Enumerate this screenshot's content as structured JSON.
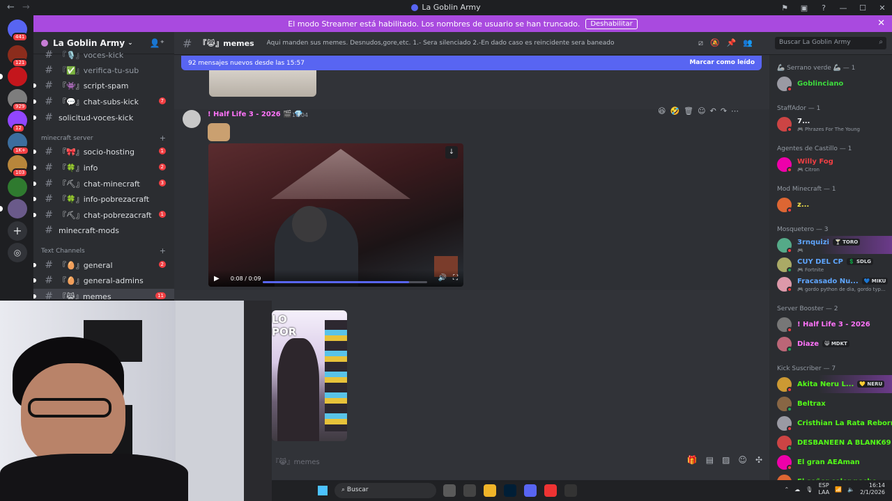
{
  "window": {
    "title": "La Goblin Army"
  },
  "banner": {
    "text": "El modo Streamer está habilitado. Los nombres de usuario se han truncado.",
    "button": "Deshabilitar"
  },
  "servers": [
    {
      "badge": "441"
    },
    {
      "badge": "121"
    },
    {
      "badge": ""
    },
    {
      "badge": "929"
    },
    {
      "badge": "12"
    },
    {
      "badge": "1K+"
    },
    {
      "badge": "103"
    },
    {
      "badge": ""
    },
    {
      "badge": ""
    }
  ],
  "sidebar": {
    "server_name": "La Goblin Army",
    "channels_top": [
      {
        "name": "『🎙️』voces-kick",
        "count": ""
      },
      {
        "name": "『✅』verifica-tu-sub",
        "count": ""
      },
      {
        "name": "『👾』script-spam",
        "count": ""
      },
      {
        "name": "『💬』chat-subs-kick",
        "count": "7"
      },
      {
        "name": "solicitud-voces-kick",
        "count": ""
      }
    ],
    "cat_minecraft": "minecraft server",
    "channels_mc": [
      {
        "name": "『🎀』socio-hosting",
        "count": "1"
      },
      {
        "name": "『🍀』info",
        "count": "2"
      },
      {
        "name": "『⛏』chat-minecraft",
        "count": "3"
      },
      {
        "name": "『🍀』info-pobrezacraft",
        "count": ""
      },
      {
        "name": "『⛏』chat-pobrezacraft",
        "count": "1"
      },
      {
        "name": "minecraft-mods",
        "count": ""
      }
    ],
    "cat_text": "Text Channels",
    "channels_text": [
      {
        "name": "『🥚』general",
        "count": "2"
      },
      {
        "name": "『🥚』general-admins",
        "count": ""
      },
      {
        "name": "『😹』memes",
        "count": "11"
      }
    ]
  },
  "channel": {
    "name": "『😹』memes",
    "topic": "Aqui manden sus memes. Desnudos,gore,etc. 1.- Sera silenciado 2.-En dado caso es reincidente sera baneado",
    "search_placeholder": "Buscar La Goblin Army"
  },
  "newbar": {
    "text": "92 mensajes nuevos desde las 15:57",
    "mark": "Marcar como leído"
  },
  "message": {
    "author": "! Half Life 3 - 2026",
    "time": "16:04",
    "video_time": "0:08 / 0:09",
    "video_progress": 0.89,
    "image_caption": "LO POR"
  },
  "input": {
    "placeholder": "『😹』memes"
  },
  "members": {
    "groups": [
      {
        "name": "🦾 Serrano verde 🦾 — 1",
        "items": [
          {
            "name": "Goblinciano",
            "color": "#3ddc3d",
            "sub": "",
            "tag": ""
          }
        ]
      },
      {
        "name": "StaffAdor — 1",
        "items": [
          {
            "name": "7...",
            "color": "#f2f3f5",
            "sub": "🎮 Phrazes For The Young",
            "tag": ""
          }
        ]
      },
      {
        "name": "Agentes de Castillo — 1",
        "items": [
          {
            "name": "Willy Fog",
            "color": "#f23f43",
            "sub": "🎮 Citron",
            "tag": ""
          }
        ]
      },
      {
        "name": "Mod Minecraft — 1",
        "items": [
          {
            "name": "z...",
            "color": "#f2e24a",
            "sub": "",
            "tag": ""
          }
        ]
      },
      {
        "name": "Mosquetero — 3",
        "items": [
          {
            "name": "3rnquizi",
            "color": "#5fa6ff",
            "sub": "🎮",
            "tag": "🍸 TORO"
          },
          {
            "name": "CUY DEL CP",
            "color": "#5fa6ff",
            "sub": "🎮 Fortnite",
            "tag": "💲 SDLG"
          },
          {
            "name": "Fracasado Nu...",
            "color": "#5fa6ff",
            "sub": "🎮 gordo python de dia, gordo typ...",
            "tag": "💙 MIKU"
          }
        ]
      },
      {
        "name": "Server Booster — 2",
        "items": [
          {
            "name": "! Half Life 3 - 2026",
            "color": "#ff73fa",
            "sub": "",
            "tag": ""
          },
          {
            "name": "Diaze",
            "color": "#ff73fa",
            "sub": "",
            "tag": "😸 MDKT"
          }
        ]
      },
      {
        "name": "Kick Suscriber — 7",
        "items": [
          {
            "name": "Akita Neru L...",
            "color": "#53fc18",
            "sub": "",
            "tag": "💛 NERU"
          },
          {
            "name": "Beltrax",
            "color": "#53fc18",
            "sub": "",
            "tag": ""
          },
          {
            "name": "Cristhian La Rata Reborn",
            "color": "#53fc18",
            "sub": "",
            "tag": ""
          },
          {
            "name": "DESBANEEN A BLANK69",
            "color": "#53fc18",
            "sub": "",
            "tag": ""
          },
          {
            "name": "El gran AEAman",
            "color": "#53fc18",
            "sub": "",
            "tag": ""
          },
          {
            "name": "El señor color noche",
            "color": "#53fc18",
            "sub": "",
            "tag": ""
          }
        ]
      }
    ]
  },
  "taskbar": {
    "search": "Buscar",
    "lang": "ESP",
    "lang2": "LAA",
    "time": "16:14",
    "date": "2/1/2026"
  }
}
